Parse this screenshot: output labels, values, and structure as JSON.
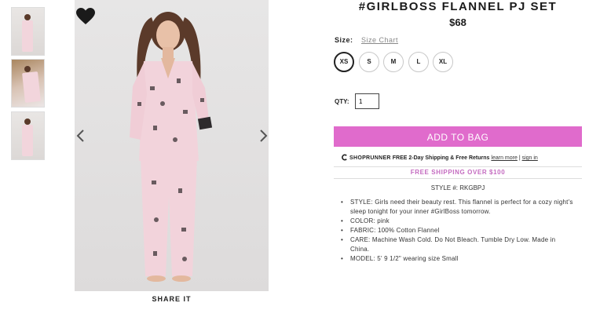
{
  "product": {
    "title": "#GIRLBOSS FLANNEL PJ SET",
    "price": "$68"
  },
  "gallery": {
    "thumbnails": [
      "thumbnail-1",
      "thumbnail-2",
      "thumbnail-3"
    ],
    "share_label": "SHARE IT",
    "favorite_icon": "heart-icon",
    "prev_icon": "chevron-left-icon",
    "next_icon": "chevron-right-icon"
  },
  "size": {
    "label": "Size:",
    "chart_link": "Size Chart",
    "options": [
      "XS",
      "S",
      "M",
      "L",
      "XL"
    ],
    "selected": "XS"
  },
  "quantity": {
    "label": "QTY:",
    "value": "1"
  },
  "cart": {
    "add_label": "ADD TO BAG",
    "button_color": "#e06bcc"
  },
  "shoprunner": {
    "brand": "SHOPRUNNER",
    "offer": "FREE 2-Day Shipping & Free Returns",
    "learn_more": "learn more",
    "separator": "|",
    "sign_in": "sign in"
  },
  "promo": {
    "free_shipping": "FREE SHIPPING OVER $100",
    "color": "#c46bc0"
  },
  "style_number": "STYLE #:  RKGBPJ",
  "details": [
    "STYLE: Girls need their beauty rest. This flannel is perfect for a cozy night's sleep tonight for your inner #GirlBoss tomorrow.",
    "COLOR: pink",
    "FABRIC: 100% Cotton Flannel",
    "CARE: Machine Wash Cold. Do Not Bleach. Tumble Dry Low. Made in China.",
    "MODEL: 5' 9 1/2\" wearing size Small"
  ]
}
